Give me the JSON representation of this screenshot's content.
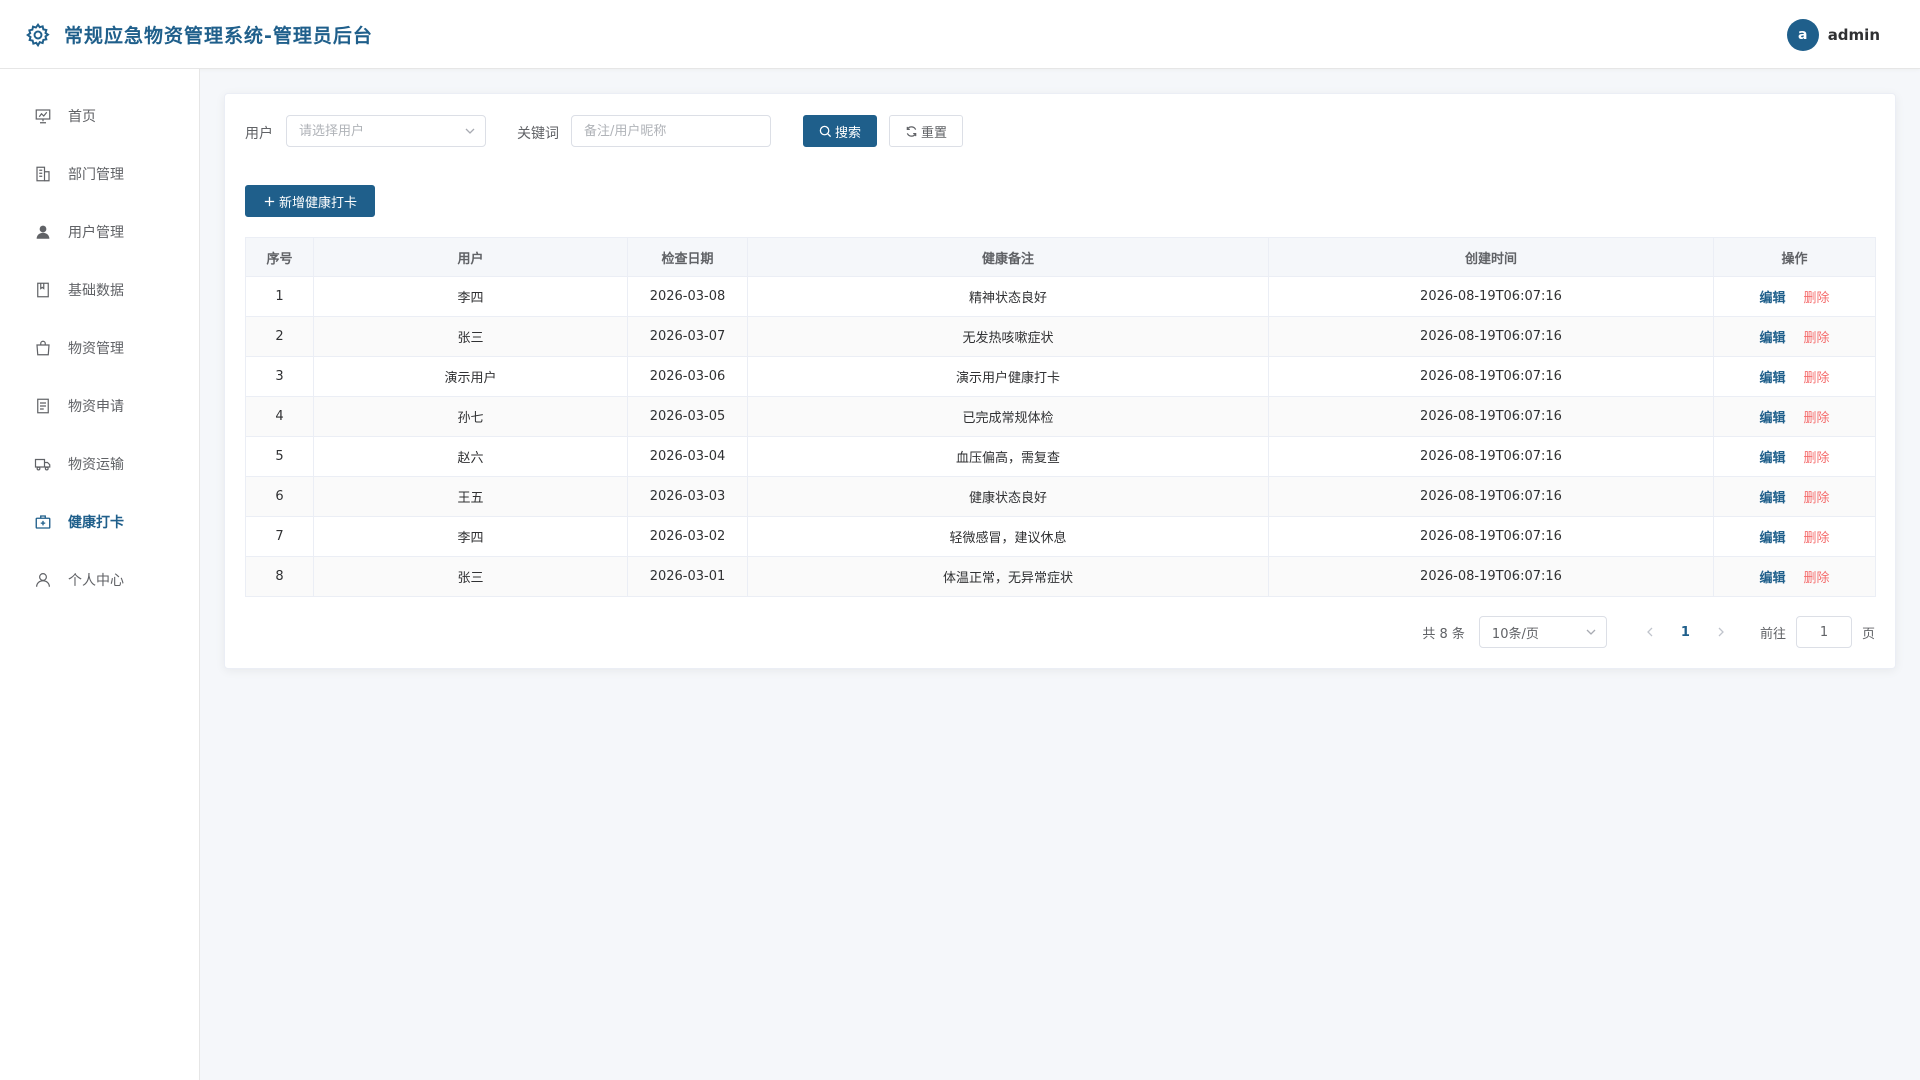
{
  "app": {
    "title": "常规应急物资管理系统-管理员后台"
  },
  "user": {
    "avatar": "a",
    "name": "admin"
  },
  "sidebar": {
    "items": [
      {
        "label": "首页",
        "icon": "dashboard-icon"
      },
      {
        "label": "部门管理",
        "icon": "building-icon"
      },
      {
        "label": "用户管理",
        "icon": "user-filled-icon"
      },
      {
        "label": "基础数据",
        "icon": "notebook-icon"
      },
      {
        "label": "物资管理",
        "icon": "shopping-bag-icon"
      },
      {
        "label": "物资申请",
        "icon": "document-icon"
      },
      {
        "label": "物资运输",
        "icon": "truck-icon"
      },
      {
        "label": "健康打卡",
        "icon": "first-aid-kit-icon",
        "active": true
      },
      {
        "label": "个人中心",
        "icon": "user-icon"
      }
    ]
  },
  "filters": {
    "user_label": "用户",
    "user_placeholder": "请选择用户",
    "keyword_label": "关键词",
    "keyword_placeholder": "备注/用户昵称",
    "search_label": "搜索",
    "reset_label": "重置"
  },
  "toolbar": {
    "add_label": "新增健康打卡"
  },
  "table": {
    "headers": {
      "index": "序号",
      "user": "用户",
      "date": "检查日期",
      "note": "健康备注",
      "created": "创建时间",
      "actions": "操作"
    },
    "edit_label": "编辑",
    "delete_label": "删除",
    "rows": [
      {
        "index": "1",
        "user": "李四",
        "date": "2026-03-08",
        "note": "精神状态良好",
        "created": "2026-08-19T06:07:16"
      },
      {
        "index": "2",
        "user": "张三",
        "date": "2026-03-07",
        "note": "无发热咳嗽症状",
        "created": "2026-08-19T06:07:16"
      },
      {
        "index": "3",
        "user": "演示用户",
        "date": "2026-03-06",
        "note": "演示用户健康打卡",
        "created": "2026-08-19T06:07:16"
      },
      {
        "index": "4",
        "user": "孙七",
        "date": "2026-03-05",
        "note": "已完成常规体检",
        "created": "2026-08-19T06:07:16"
      },
      {
        "index": "5",
        "user": "赵六",
        "date": "2026-03-04",
        "note": "血压偏高，需复查",
        "created": "2026-08-19T06:07:16"
      },
      {
        "index": "6",
        "user": "王五",
        "date": "2026-03-03",
        "note": "健康状态良好",
        "created": "2026-08-19T06:07:16"
      },
      {
        "index": "7",
        "user": "李四",
        "date": "2026-03-02",
        "note": "轻微感冒，建议休息",
        "created": "2026-08-19T06:07:16"
      },
      {
        "index": "8",
        "user": "张三",
        "date": "2026-03-01",
        "note": "体温正常，无异常症状",
        "created": "2026-08-19T06:07:16"
      }
    ]
  },
  "pagination": {
    "total_text": "共 8 条",
    "page_size": "10条/页",
    "current_page": "1",
    "goto_label": "前往",
    "jump_value": "1",
    "page_unit": "页"
  },
  "colors": {
    "primary": "#1f5f8b",
    "danger": "#f56c6c"
  }
}
